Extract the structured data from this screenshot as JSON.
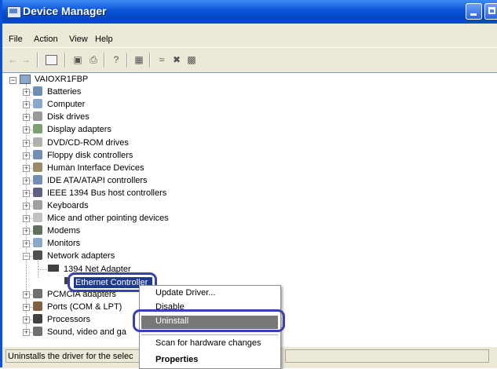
{
  "window": {
    "title": "Device Manager"
  },
  "menu": [
    "File",
    "Action",
    "View",
    "Help"
  ],
  "tree": {
    "root": "VAIOXR1FBP",
    "categories": [
      {
        "label": "Batteries",
        "icon": "battery-icon",
        "color": "#6f8fb0"
      },
      {
        "label": "Computer",
        "icon": "computer-icon",
        "color": "#8ca8c8"
      },
      {
        "label": "Disk drives",
        "icon": "disk-drive-icon",
        "color": "#9a9a9a"
      },
      {
        "label": "Display adapters",
        "icon": "display-adapter-icon",
        "color": "#7da070"
      },
      {
        "label": "DVD/CD-ROM drives",
        "icon": "dvd-drive-icon",
        "color": "#b0b0b0"
      },
      {
        "label": "Floppy disk controllers",
        "icon": "floppy-controller-icon",
        "color": "#7090b0"
      },
      {
        "label": "Human Interface Devices",
        "icon": "hid-icon",
        "color": "#9a8a6a"
      },
      {
        "label": "IDE ATA/ATAPI controllers",
        "icon": "ide-controller-icon",
        "color": "#7090b0"
      },
      {
        "label": "IEEE 1394 Bus host controllers",
        "icon": "ieee1394-icon",
        "color": "#606080"
      },
      {
        "label": "Keyboards",
        "icon": "keyboard-icon",
        "color": "#a0a0a0"
      },
      {
        "label": "Mice and other pointing devices",
        "icon": "mouse-icon",
        "color": "#c0c0c0"
      },
      {
        "label": "Modems",
        "icon": "modem-icon",
        "color": "#607060"
      },
      {
        "label": "Monitors",
        "icon": "monitor-icon",
        "color": "#8ca8c8"
      },
      {
        "label": "Network adapters",
        "icon": "network-adapter-icon",
        "color": "#505050"
      }
    ],
    "network_children": [
      {
        "label": "1394 Net Adapter",
        "icon": "net-adapter-icon"
      },
      {
        "label": "Ethernet Controller",
        "icon": "ethernet-icon"
      }
    ],
    "after_categories": [
      {
        "label": "PCMCIA adapters",
        "icon": "pcmcia-icon",
        "color": "#707070"
      },
      {
        "label": "Ports (COM & LPT)",
        "icon": "ports-icon",
        "color": "#806040"
      },
      {
        "label": "Processors",
        "icon": "processor-icon",
        "color": "#404040"
      },
      {
        "label": "Sound, video and ga",
        "icon": "sound-icon",
        "color": "#707070"
      }
    ]
  },
  "context_menu": {
    "items": [
      "Update Driver...",
      "Disable",
      "Uninstall",
      "Scan for hardware changes",
      "Properties"
    ],
    "selected": "Uninstall"
  },
  "status": {
    "text": "Uninstalls the driver for the selec"
  }
}
